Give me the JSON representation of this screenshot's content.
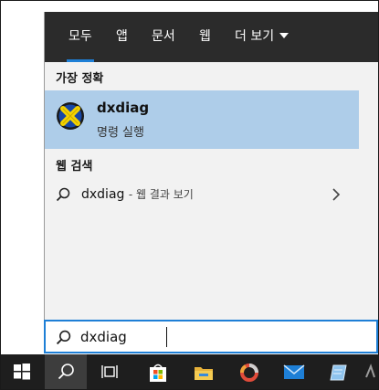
{
  "tabs": [
    {
      "label": "모두",
      "active": true
    },
    {
      "label": "앱"
    },
    {
      "label": "문서"
    },
    {
      "label": "웹"
    },
    {
      "label": "더 보기"
    }
  ],
  "best_match": {
    "header": "가장 정확",
    "app_name": "dxdiag",
    "app_type": "명령 실행",
    "icon": "directx-icon"
  },
  "web_search": {
    "header": "웹 검색",
    "query": "dxdiag",
    "hint": "- 웹 결과 보기"
  },
  "search_box": {
    "value": "dxdiag"
  },
  "taskbar": {
    "items": [
      "windows-start-icon",
      "search-icon",
      "task-view-icon",
      "store-icon",
      "file-explorer-icon",
      "app-ring-icon",
      "mail-icon",
      "notepad-icon",
      "partial-app-icon"
    ]
  },
  "colors": {
    "accent": "#1e7fd6",
    "selected_bg": "#aecde9",
    "tabs_bg": "#2b2b2b",
    "taskbar_bg": "#1e1e1e"
  }
}
